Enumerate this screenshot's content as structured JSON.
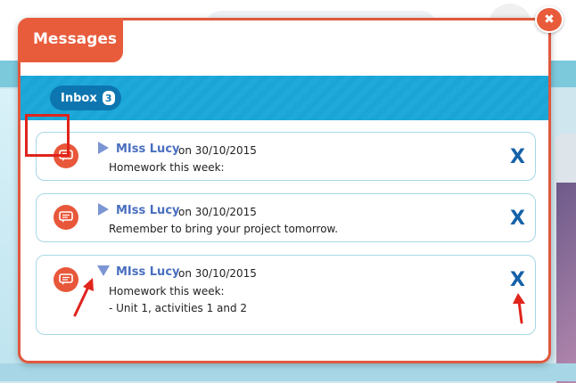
{
  "modal": {
    "title": "Messages",
    "close_icon": "close-icon",
    "tabs": [
      {
        "label": "Inbox",
        "count": "3"
      }
    ]
  },
  "messages": [
    {
      "sender": "MIss Lucy",
      "date": "on 30/10/2015",
      "lines": [
        "Homework this week:"
      ],
      "expanded": false,
      "icon": "message-icon",
      "delete_label": "X"
    },
    {
      "sender": "MIss Lucy",
      "date": "on 30/10/2015",
      "lines": [
        "Remember to bring your project tomorrow."
      ],
      "expanded": false,
      "icon": "message-icon",
      "delete_label": "X"
    },
    {
      "sender": "MIss Lucy",
      "date": "on 30/10/2015",
      "lines": [
        "Homework this week:",
        "- Unit 1, activities 1 and 2"
      ],
      "expanded": true,
      "icon": "message-icon",
      "delete_label": "X"
    }
  ],
  "colors": {
    "accent": "#e85c3c",
    "tab_bar": "#1aa5d6",
    "sender": "#4a6fc0",
    "delete": "#1562a8",
    "annotation": "#e0241c"
  }
}
